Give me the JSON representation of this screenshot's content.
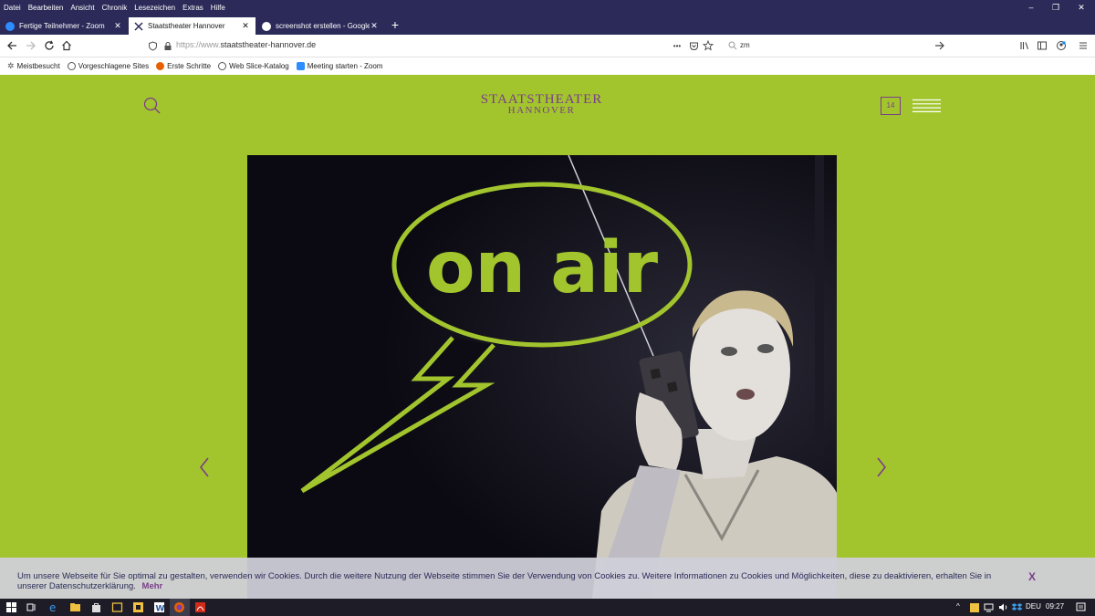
{
  "menubar": {
    "items": [
      "Datei",
      "Bearbeiten",
      "Ansicht",
      "Chronik",
      "Lesezeichen",
      "Extras",
      "Hilfe"
    ]
  },
  "window_controls": {
    "minimize": "–",
    "restore": "❐",
    "close": "✕"
  },
  "tabs": [
    {
      "label": "Fertige Teilnehmer - Zoom",
      "favicon_color": "#2d8cff",
      "active": false
    },
    {
      "label": "Staatstheater Hannover",
      "favicon_color": "",
      "active": true
    },
    {
      "label": "screenshot erstellen - Google-S",
      "favicon_color": "#ffffff",
      "active": false
    }
  ],
  "new_tab_label": "+",
  "navbar": {
    "url_scheme": "https://www.",
    "url_domain": "staatstheater-hannover.de",
    "search_text": "zm",
    "dots": "•••"
  },
  "bookmarks": [
    {
      "label": "Meistbesucht",
      "icon": "gear-icon"
    },
    {
      "label": "Vorgeschlagene Sites",
      "icon": "globe-icon"
    },
    {
      "label": "Erste Schritte",
      "icon": "firefox-icon"
    },
    {
      "label": "Web Slice-Katalog",
      "icon": "globe-icon"
    },
    {
      "label": "Meeting starten - Zoom",
      "icon": "zoom-icon"
    }
  ],
  "site": {
    "logo_line1": "STAATSTHEATER",
    "logo_line2": "HANNOVER",
    "calendar_number": "14",
    "hero_text": "on air",
    "accent_color": "#a2c52e",
    "brand_color": "#7b3d8a"
  },
  "cookie_banner": {
    "text": "Um unsere Webseite für Sie optimal zu gestalten, verwenden wir Cookies. Durch die weitere Nutzung der Webseite stimmen Sie der Verwendung von Cookies zu. Weitere Informationen zu Cookies und Möglichkeiten, diese zu deaktivieren, erhalten Sie in unserer Datenschutzerklärung.",
    "more_label": "Mehr",
    "close_label": "X"
  },
  "taskbar": {
    "language": "DEU",
    "time": "09:27"
  }
}
